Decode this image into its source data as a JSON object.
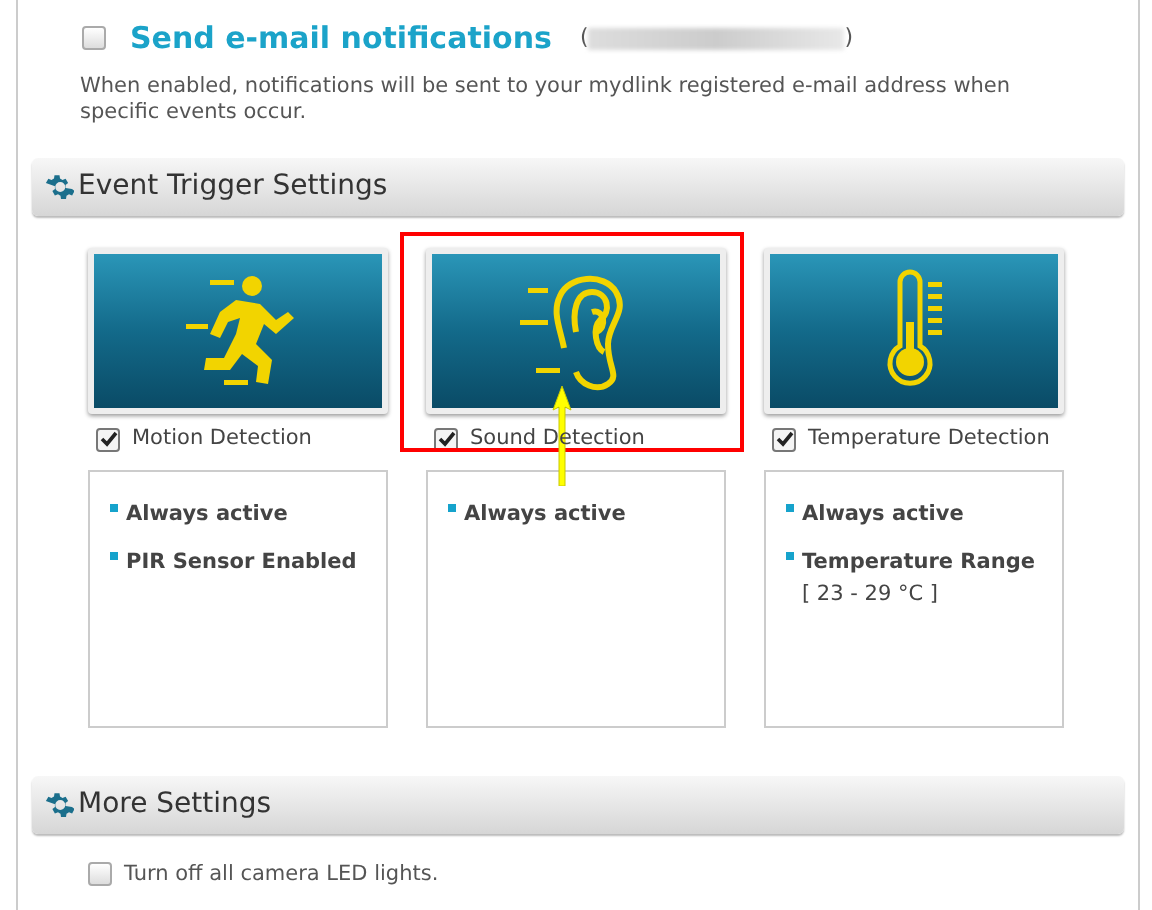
{
  "email_notifications": {
    "label": "Send e-mail notifications",
    "checked": false,
    "open_paren": "(",
    "close_paren": ")",
    "description": "When enabled, notifications will be sent to your mydlink registered e-mail address when specific events occur."
  },
  "event_trigger": {
    "title": "Event Trigger Settings",
    "triggers": [
      {
        "kind": "motion",
        "label": "Motion Detection",
        "checked": true,
        "highlighted": false,
        "items": [
          {
            "title": "Always active"
          },
          {
            "title": "PIR Sensor Enabled"
          }
        ]
      },
      {
        "kind": "sound",
        "label": "Sound Detection",
        "checked": true,
        "highlighted": true,
        "items": [
          {
            "title": "Always active"
          }
        ]
      },
      {
        "kind": "temperature",
        "label": "Temperature Detection",
        "checked": true,
        "highlighted": false,
        "items": [
          {
            "title": "Always active"
          },
          {
            "title": "Temperature Range",
            "detail": "[ 23 - 29 °C ]"
          }
        ]
      }
    ]
  },
  "more_settings": {
    "title": "More Settings",
    "options": [
      {
        "label": "Turn off all camera LED lights.",
        "checked": false
      }
    ]
  }
}
